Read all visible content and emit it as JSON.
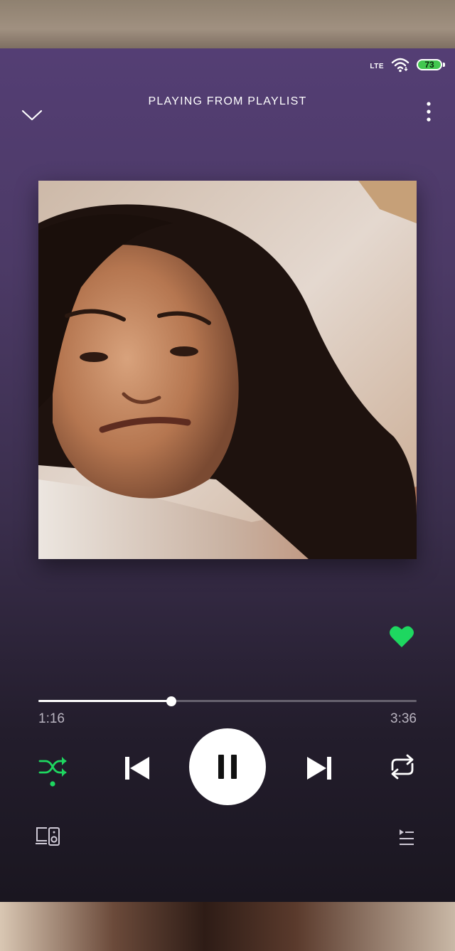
{
  "status_bar": {
    "network": "LTE",
    "battery": "73",
    "icons": [
      "wifi-icon",
      "battery-icon"
    ]
  },
  "header": {
    "title": "PLAYING FROM PLAYLIST",
    "icons": [
      "chevron-down-icon",
      "more-vertical-icon"
    ]
  },
  "track": {
    "liked": true
  },
  "playback": {
    "elapsed": "1:16",
    "duration": "3:36",
    "progress_fraction": 0.351,
    "is_playing": true,
    "shuffle_on": true,
    "repeat_on": false
  },
  "controls": {
    "icons": [
      "shuffle-icon",
      "skip-previous-icon",
      "pause-icon",
      "skip-next-icon",
      "repeat-icon",
      "devices-icon",
      "queue-icon"
    ]
  },
  "colors": {
    "accent": "#1ed760",
    "background_top": "#543e74",
    "background_bottom": "#1a1620"
  }
}
